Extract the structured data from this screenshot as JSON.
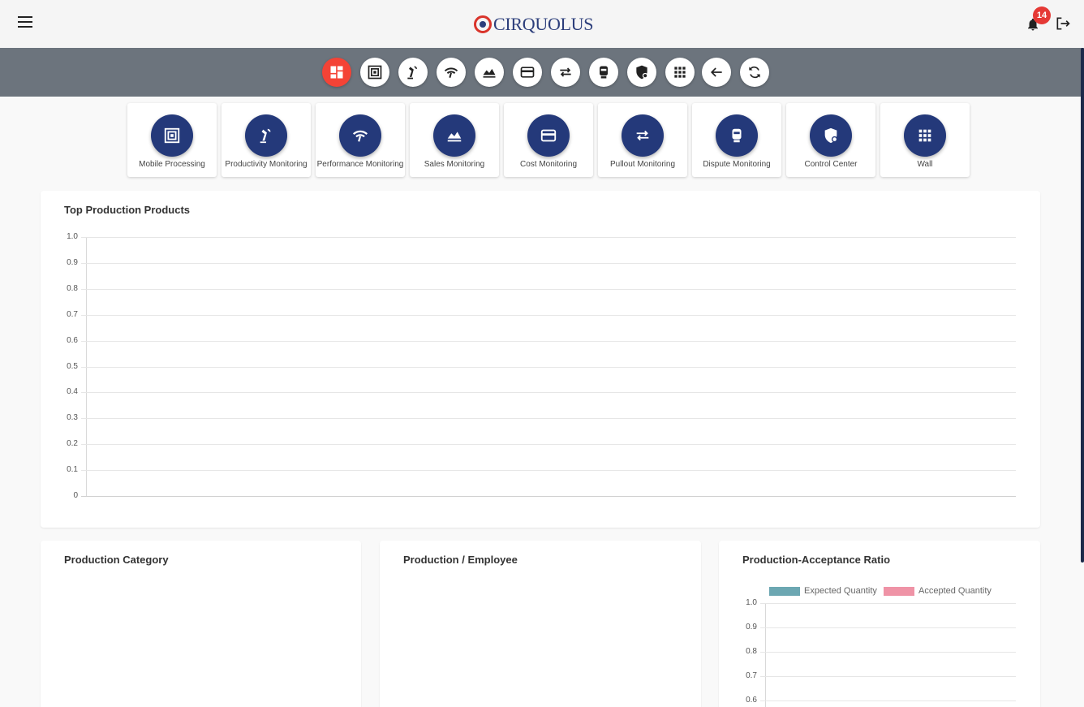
{
  "header": {
    "brand": "CIRQUOLUS",
    "notification_count": "14"
  },
  "toolbar": {
    "icons": [
      "dashboard-icon",
      "mobile-processing-icon",
      "productivity-icon",
      "performance-icon",
      "sales-icon",
      "cost-icon",
      "pullout-icon",
      "dispute-icon",
      "control-center-icon",
      "wall-icon",
      "back-arrow-icon",
      "refresh-icon"
    ],
    "active_index": 0
  },
  "modules": [
    {
      "label": "Mobile Processing",
      "icon": "mobile-processing-icon"
    },
    {
      "label": "Productivity Monitoring",
      "icon": "productivity-icon"
    },
    {
      "label": "Performance Monitoring",
      "icon": "performance-icon"
    },
    {
      "label": "Sales Monitoring",
      "icon": "sales-icon"
    },
    {
      "label": "Cost Monitoring",
      "icon": "cost-icon"
    },
    {
      "label": "Pullout Monitoring",
      "icon": "pullout-icon"
    },
    {
      "label": "Dispute Monitoring",
      "icon": "dispute-icon"
    },
    {
      "label": "Control Center",
      "icon": "control-center-icon"
    },
    {
      "label": "Wall",
      "icon": "wall-icon"
    }
  ],
  "panels": {
    "top_products": {
      "title": "Top Production Products"
    },
    "category": {
      "title": "Production Category"
    },
    "employee": {
      "title": "Production / Employee"
    },
    "ratio": {
      "title": "Production-Acceptance Ratio"
    }
  },
  "colors": {
    "brand_blue": "#24397a",
    "brand_red": "#d9342b",
    "toolbar_bg": "#6c747d",
    "active_tool": "#f44336",
    "expected": "#6ca7b2",
    "accepted": "#ef93a6"
  },
  "chart_data": [
    {
      "type": "bar",
      "title": "Top Production Products",
      "categories": [],
      "values": [],
      "yticks": [
        "1.0",
        "0.9",
        "0.8",
        "0.7",
        "0.6",
        "0.5",
        "0.4",
        "0.3",
        "0.2",
        "0.1",
        "0"
      ],
      "ylim": [
        0,
        1
      ],
      "grid": true
    },
    {
      "type": "bar",
      "title": "Production-Acceptance Ratio",
      "categories": [],
      "series": [
        {
          "name": "Expected Quantity",
          "values": [],
          "color": "#6ca7b2"
        },
        {
          "name": "Accepted Quantity",
          "values": [],
          "color": "#ef93a6"
        }
      ],
      "yticks": [
        "1.0",
        "0.9",
        "0.8",
        "0.7",
        "0.6"
      ],
      "ylim": [
        0,
        1
      ],
      "legend": "top",
      "grid": true
    }
  ]
}
